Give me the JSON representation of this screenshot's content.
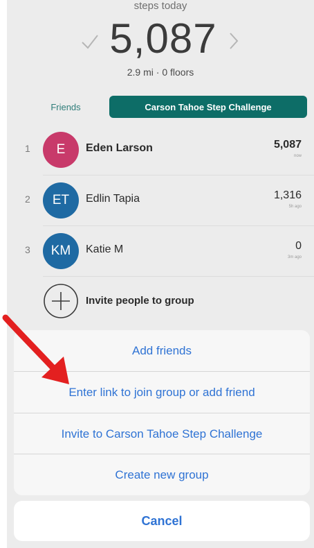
{
  "header": {
    "caption": "steps today",
    "steps": "5,087",
    "sub_stats": "2.9 mi · 0 floors"
  },
  "tabs": {
    "friends": "Friends",
    "challenge": "Carson Tahoe Step Challenge"
  },
  "leaderboard": [
    {
      "rank": "1",
      "initials": "E",
      "name": "Eden Larson",
      "steps": "5,087",
      "sub": "now",
      "color": "#c83a6a"
    },
    {
      "rank": "2",
      "initials": "ET",
      "name": "Edlin Tapia",
      "steps": "1,316",
      "sub": "5h ago",
      "color": "#1f6aa3"
    },
    {
      "rank": "3",
      "initials": "KM",
      "name": "Katie M",
      "steps": "0",
      "sub": "3m ago",
      "color": "#1f6aa3"
    }
  ],
  "invite": {
    "label": "Invite people to group"
  },
  "sheet": {
    "items": [
      "Add friends",
      "Enter link to join group or add friend",
      "Invite to Carson Tahoe Step Challenge",
      "Create new group"
    ],
    "cancel": "Cancel"
  },
  "colors": {
    "accent": "#0d6d67",
    "link": "#2f73d4",
    "annotation": "#e32020"
  }
}
